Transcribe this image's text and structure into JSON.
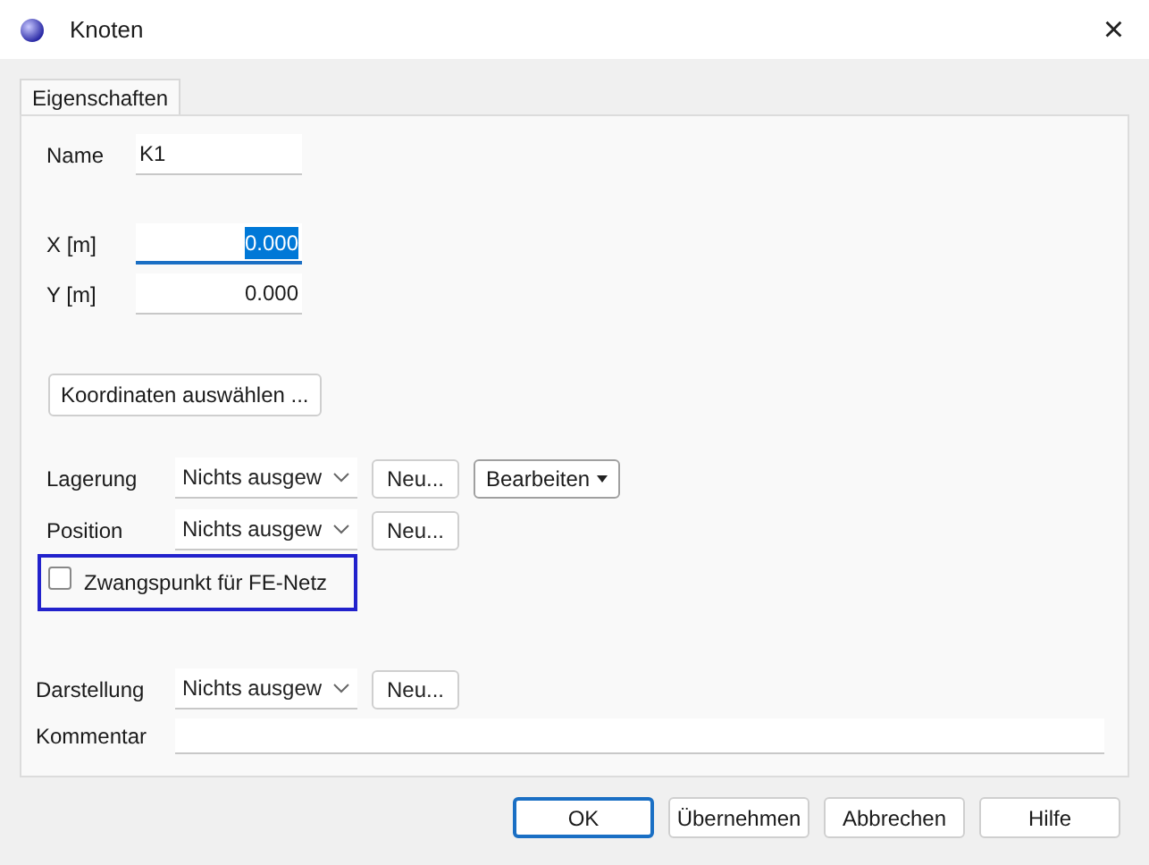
{
  "window": {
    "title": "Knoten",
    "close": "×"
  },
  "tabs": [
    {
      "label": "Eigenschaften",
      "selected": true
    }
  ],
  "name_field": {
    "label": "Name",
    "value": "K1"
  },
  "coordinates": [
    {
      "label": "X [m]",
      "value": "0.000",
      "focused": true
    },
    {
      "label": "Y [m]",
      "value": "0.000",
      "focused": false
    }
  ],
  "select_coordinates_button": "Koordinaten auswählen ...",
  "rows": [
    {
      "label": "Lagerung",
      "value": "Nichts ausgew",
      "new_button": "Neu...",
      "edit_button": "Bearbeiten"
    },
    {
      "label": "Position",
      "value": "Nichts ausgew",
      "new_button": "Neu..."
    }
  ],
  "constraint_checkbox": {
    "label": "Zwangspunkt für FE-Netz",
    "checked": false,
    "highlighted": true
  },
  "display_row": {
    "label": "Darstellung",
    "value": "Nichts ausgew",
    "new_button": "Neu..."
  },
  "comment": {
    "label": "Kommentar"
  },
  "buttons": [
    {
      "label": "OK",
      "default": true
    },
    {
      "label": "Übernehmen",
      "default": false
    },
    {
      "label": "Abbrechen",
      "default": false
    },
    {
      "label": "Hilfe",
      "default": false
    }
  ]
}
